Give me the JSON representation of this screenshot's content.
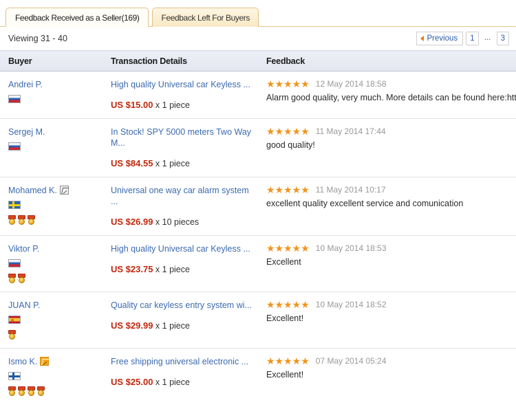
{
  "tabs": [
    {
      "label": "Feedback Received as a Seller(169)",
      "active": true
    },
    {
      "label": "Feedback Left For Buyers",
      "active": false
    }
  ],
  "viewing": "Viewing 31 - 40",
  "pager": {
    "previous_label": "Previous",
    "page_1": "1",
    "ellipsis": "...",
    "page_3": "3"
  },
  "columns": {
    "buyer": "Buyer",
    "transaction": "Transaction Details",
    "feedback": "Feedback"
  },
  "colors": {
    "link": "#3b6ab0",
    "price": "#c0280d",
    "star": "#f0941c",
    "tab_border": "#e0c089",
    "header_bg": "#e8eaf3"
  },
  "rows": [
    {
      "buyer": "Andrei P.",
      "revision_badge": null,
      "flag": "flag-ru",
      "medals": 0,
      "item_title": "High quality Universal car Keyless ...",
      "price": "US $15.00",
      "qty": "x 1 piece",
      "stars": "★★★★★",
      "date": "12 May 2014 18:58",
      "comment": "Alarm good quality, very much. More details can be found here:http://www.driv"
    },
    {
      "buyer": "Sergej M.",
      "revision_badge": null,
      "flag": "flag-ru",
      "medals": 0,
      "item_title": "In Stock! SPY 5000 meters Two Way M...",
      "price": "US $84.55",
      "qty": "x 1 piece",
      "stars": "★★★★★",
      "date": "11 May 2014 17:44",
      "comment": "good quality!"
    },
    {
      "buyer": "Mohamed K.",
      "revision_badge": "grey",
      "flag": "flag-se",
      "medals": 3,
      "item_title": "Universal one way car alarm system ...",
      "price": "US $26.99",
      "qty": "x 10 pieces",
      "stars": "★★★★★",
      "date": "11 May 2014 10:17",
      "comment": "excellent quality excellent service and comunication"
    },
    {
      "buyer": "Viktor P.",
      "revision_badge": null,
      "flag": "flag-ru",
      "medals": 2,
      "item_title": "High quality Universal car Keyless ...",
      "price": "US $23.75",
      "qty": "x 1 piece",
      "stars": "★★★★★",
      "date": "10 May 2014 18:53",
      "comment": "Excellent"
    },
    {
      "buyer": "JUAN P.",
      "revision_badge": null,
      "flag": "flag-es",
      "medals": 1,
      "item_title": "Quality car keyless entry system wi...",
      "price": "US $29.99",
      "qty": "x 1 piece",
      "stars": "★★★★★",
      "date": "10 May 2014 18:52",
      "comment": "Excellent!"
    },
    {
      "buyer": "Ismo K.",
      "revision_badge": "gold",
      "flag": "flag-fi",
      "medals": 4,
      "item_title": "Free shipping universal electronic ...",
      "price": "US $25.00",
      "qty": "x 1 piece",
      "stars": "★★★★★",
      "date": "07 May 2014 05:24",
      "comment": "Excellent!"
    }
  ]
}
